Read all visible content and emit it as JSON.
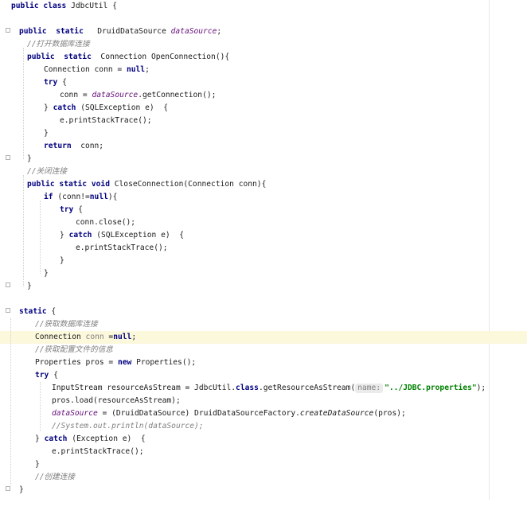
{
  "editor": {
    "language": "java",
    "class_header": [
      "public class",
      " JdbcUtil {"
    ],
    "field_decl": [
      "public",
      "  static",
      "   DruidDataSource ",
      "dataSource",
      ";"
    ],
    "comment_open": "//打开数据库连接",
    "open_sig": [
      "public",
      "  static",
      "  Connection OpenConnection(){"
    ],
    "open_conn": [
      "Connection conn = ",
      "null",
      ";"
    ],
    "try1": [
      "try",
      " {"
    ],
    "conn_assign": [
      "conn = ",
      "dataSource",
      ".getConnection();"
    ],
    "catch1": [
      "} ",
      "catch",
      " (SQLException e)  {"
    ],
    "print1": "e.printStackTrace();",
    "close_brace": "}",
    "return_stmt": [
      "return",
      "  conn;"
    ],
    "comment_close": "//关闭连接",
    "close_sig": [
      "public static void",
      " CloseConnection(Connection conn){"
    ],
    "if_stmt": [
      "if",
      " (conn!=",
      "null",
      "){"
    ],
    "try2": [
      "try",
      " {"
    ],
    "conn_close": "conn.close();",
    "catch2": [
      "} ",
      "catch",
      " (SQLException e)  {"
    ],
    "print2": "e.printStackTrace();",
    "static_block": [
      "static",
      " {"
    ],
    "comment_get": "//获取数据库连接",
    "conn_null": [
      "Connection ",
      "conn",
      " =",
      "null",
      ";"
    ],
    "comment_cfg": "//获取配置文件的信息",
    "props_decl": [
      "Properties pros = ",
      "new",
      " Properties();"
    ],
    "try3": [
      "try",
      " {"
    ],
    "stream_decl": [
      "InputStream resourceAsStream = JdbcUtil.",
      "class",
      ".getResourceAsStream(",
      "name:",
      "\"../JDBC.properties\"",
      ");"
    ],
    "props_load": "pros.load(resourceAsStream);",
    "ds_assign": [
      "dataSource",
      " = (DruidDataSource) DruidDataSourceFactory.",
      "createDataSource",
      "(pros);"
    ],
    "sysout_comment": "//System.out.println(dataSource);",
    "catch3": [
      "} ",
      "catch",
      " (Exception e)  {"
    ],
    "print3": "e.printStackTrace();",
    "comment_create": "//创建连接"
  }
}
